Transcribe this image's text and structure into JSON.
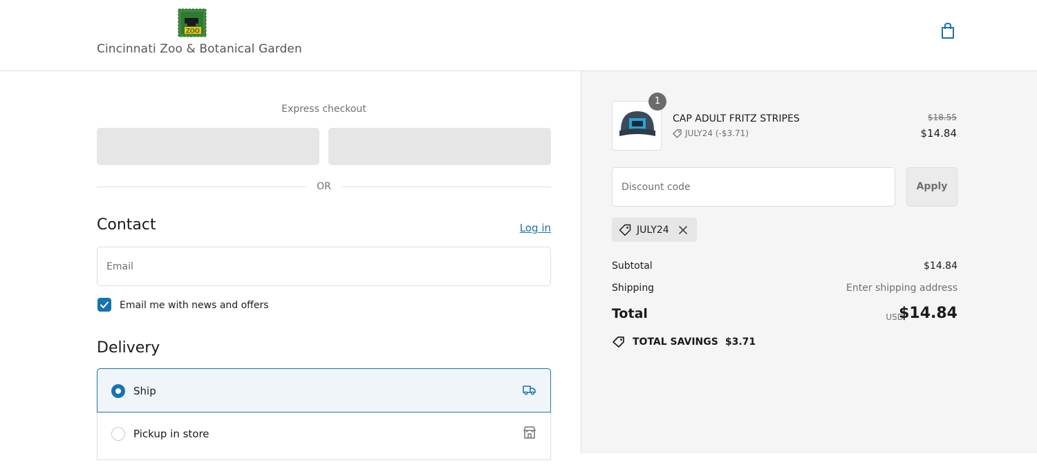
{
  "header": {
    "logo_badge": "ZOO",
    "logo_text": "Cincinnati Zoo & Botanical Garden"
  },
  "express": {
    "label": "Express checkout",
    "or": "OR"
  },
  "contact": {
    "heading": "Contact",
    "login": "Log in",
    "email_placeholder": "Email",
    "newsletter_label": "Email me with news and offers"
  },
  "delivery": {
    "heading": "Delivery",
    "options": [
      {
        "label": "Ship",
        "selected": true
      },
      {
        "label": "Pickup in store",
        "selected": false
      }
    ]
  },
  "cart": {
    "quantity": "1",
    "product_name": "CAP ADULT FRITZ STRIPES",
    "discount_line": "JULY24 (-$3.71)",
    "original_price": "$18.55",
    "price": "$14.84",
    "discount_placeholder": "Discount code",
    "apply": "Apply",
    "applied_code": "JULY24",
    "subtotal_label": "Subtotal",
    "subtotal": "$14.84",
    "shipping_label": "Shipping",
    "shipping": "Enter shipping address",
    "total_label": "Total",
    "currency": "USD",
    "total": "$14.84",
    "savings_label": "TOTAL SAVINGS",
    "savings": "$3.71"
  },
  "colors": {
    "accent": "#1773b0",
    "panel_bg": "#f5f5f5"
  }
}
